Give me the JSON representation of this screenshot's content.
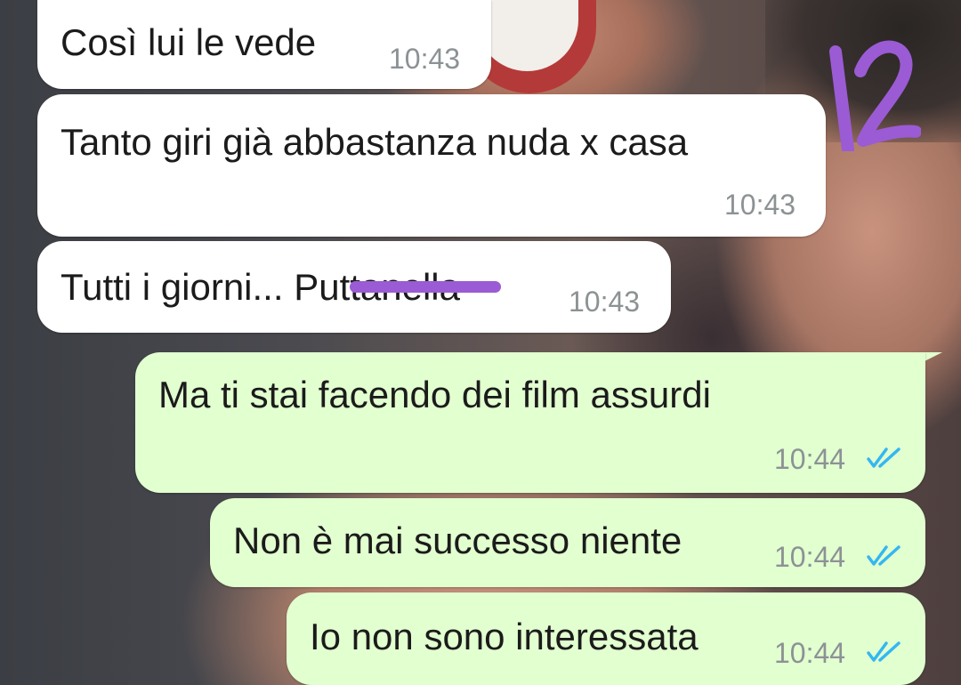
{
  "annotation": {
    "number": "12",
    "color": "#9b5bd4"
  },
  "messages": [
    {
      "direction": "incoming",
      "text": "Così lui le vede",
      "time": "10:43"
    },
    {
      "direction": "incoming",
      "text": "Tanto giri già abbastanza nuda x casa",
      "time": "10:43"
    },
    {
      "direction": "incoming",
      "text": "Tutti i giorni... Puttanella",
      "time": "10:43",
      "redacted": "uttanel"
    },
    {
      "direction": "outgoing",
      "text": "Ma ti stai facendo dei film assurdi",
      "time": "10:44",
      "status": "read"
    },
    {
      "direction": "outgoing",
      "text": "Non è mai successo niente",
      "time": "10:44",
      "status": "read"
    },
    {
      "direction": "outgoing",
      "text": "Io non sono interessata",
      "time": "10:44",
      "status": "read"
    }
  ],
  "colors": {
    "incoming_bubble": "#ffffff",
    "outgoing_bubble": "#e2ffd0",
    "read_ticks": "#34b7f1",
    "timestamp": "#8c9294"
  },
  "icons": {
    "read_receipt": "double-check-icon"
  }
}
